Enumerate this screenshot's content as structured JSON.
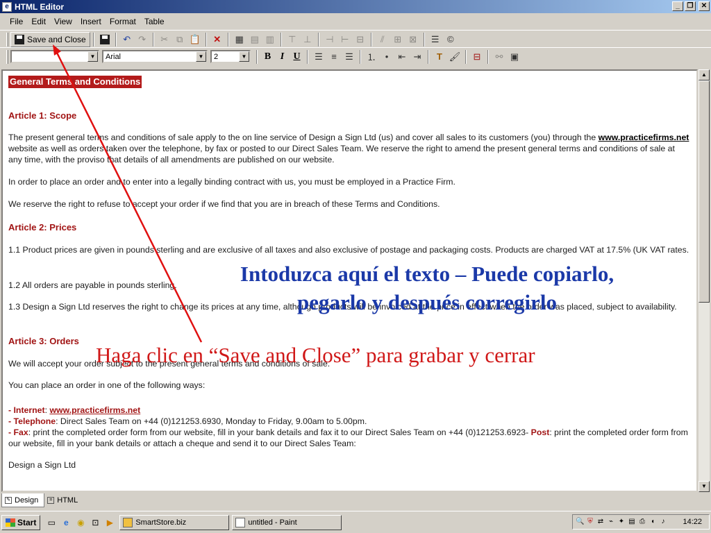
{
  "window": {
    "title": "HTML Editor",
    "icon": "app-icon",
    "controls": [
      "_",
      "❐",
      "✕"
    ]
  },
  "menu": [
    "File",
    "Edit",
    "View",
    "Insert",
    "Format",
    "Table"
  ],
  "toolbar1": {
    "save_close_label": "Save and Close"
  },
  "toolbar2": {
    "style_value": "",
    "font_value": "Arial",
    "size_value": "2",
    "bold": "B",
    "italic": "I",
    "underline": "U"
  },
  "document": {
    "title": "General Terms and Conditions",
    "a1_heading": "Article 1: Scope",
    "a1_p1_pre": "The present general terms and conditions of sale apply to the on line service of Design a Sign Ltd (us) and cover all sales to its customers (you) through the ",
    "a1_p1_link": "www.practicefirms.net",
    "a1_p1_post": " website as well as orders taken over the telephone, by fax or posted to our Direct Sales Team. We reserve the right to amend the present general terms and conditions of sale at any time, with the proviso that details of all amendments are published on our website.",
    "a1_p2": "In order to place an order and to enter into a legally binding contract with us, you must be employed in a Practice Firm.",
    "a1_p3": "We reserve the right to refuse to accept your order if we find that you are in breach of these Terms and Conditions.",
    "a2_heading": "Article 2: Prices",
    "a2_p1": "1.1 Product prices are given in pounds sterling and are exclusive of all taxes and also exclusive of postage and packaging costs. Products are charged VAT at 17.5% (UK VAT rates.",
    "a2_p2": "1.2 All orders are payable in pounds sterling.",
    "a2_p3": "1.3 Design a Sign Ltd reserves the right to change its prices at any time, although products will be invoiced at the price in effect when the order was placed, subject to availability.",
    "a3_heading": "Article 3: Orders",
    "a3_p1": "We will accept your order subject to the present general terms and conditions of sale.",
    "a3_p2": "You can place an order in one of the following ways:",
    "li1_label": "- Internet",
    "li1_sep": ": ",
    "li1_link": "www.practicefirms.net",
    "li2_label": "- Telephone",
    "li2_text": ": Direct Sales Team on +44 (0)121253.6930, Monday to Friday, 9.00am to 5.00pm.",
    "li3_label": "- Fax",
    "li3_text": ": print the completed order form from our website, fill in your bank details and fax it to our Direct Sales Team on +44 (0)121253.6923- ",
    "li3_post_label": "Post",
    "li3_post_text": ": print the completed order form from our website, fill in your bank details or attach a cheque and send it to our Direct Sales Team:",
    "address1": "Design a Sign Ltd"
  },
  "annotations": {
    "blue_line1": "Intoduzca aquí el texto – Puede copiarlo,",
    "blue_line2": "pegarlo y después corregirlo",
    "red_text": "Haga clic en “Save and Close” para grabar y cerrar",
    "blue_color": "#1b39a8",
    "red_color": "#d01818"
  },
  "tabs": [
    {
      "label": "Design",
      "active": true
    },
    {
      "label": "HTML",
      "active": false
    }
  ],
  "taskbar": {
    "start_label": "Start",
    "tasks": [
      {
        "label": "SmartStore.biz"
      },
      {
        "label": "untitled - Paint"
      }
    ],
    "clock": "14:22"
  }
}
